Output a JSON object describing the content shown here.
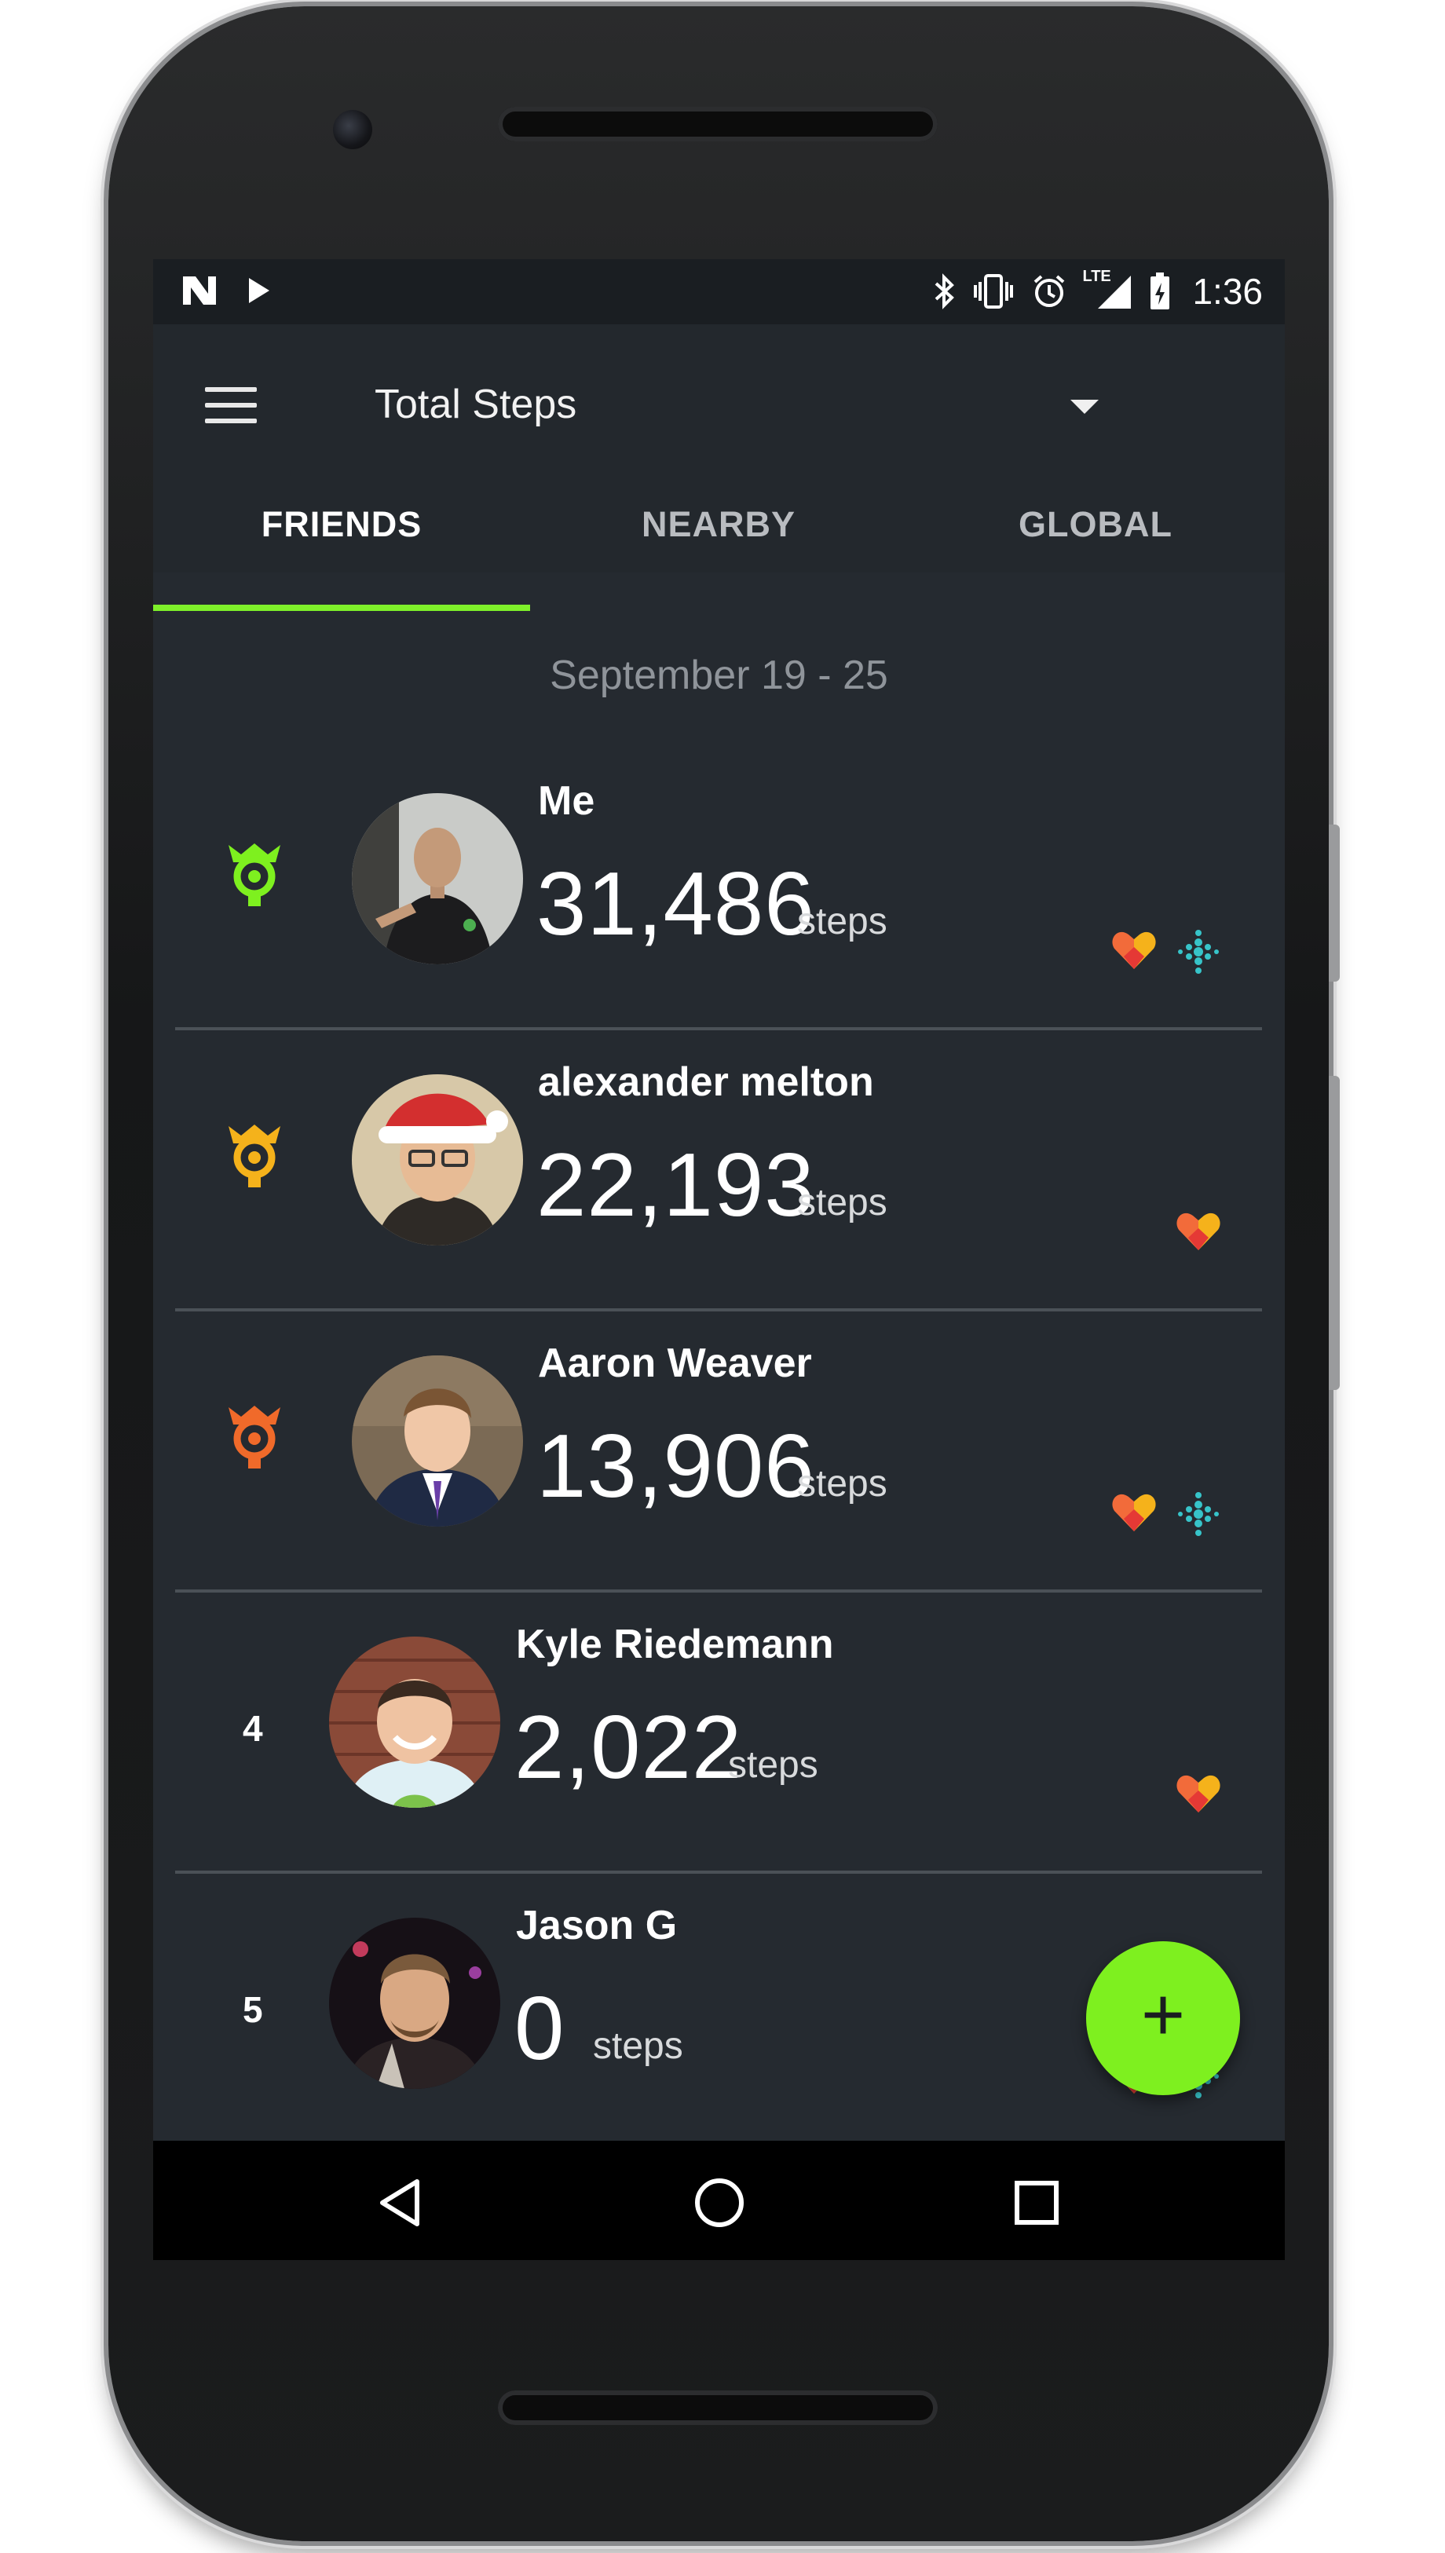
{
  "status_bar": {
    "time": "1:36",
    "network": "LTE",
    "left_icons": [
      "notification-n-icon",
      "play-store-icon"
    ],
    "right_icons": [
      "bluetooth-icon",
      "vibrate-icon",
      "alarm-icon",
      "signal-icon",
      "battery-icon"
    ]
  },
  "appbar": {
    "title": "Total Steps",
    "menu_icon": "menu-icon",
    "dropdown_icon": "dropdown-arrow-icon"
  },
  "tabs": [
    {
      "label": "FRIENDS",
      "active": true
    },
    {
      "label": "NEARBY",
      "active": false
    },
    {
      "label": "GLOBAL",
      "active": false
    }
  ],
  "date_range": "September 19 - 25",
  "leaderboard": [
    {
      "rank": "1",
      "badge_color": "#7ef01f",
      "name": "Me",
      "steps": "31,486",
      "unit": "steps",
      "sources": [
        "google-fit-icon",
        "fitbit-icon"
      ]
    },
    {
      "rank": "2",
      "badge_color": "#f5b21b",
      "name": "alexander melton",
      "steps": "22,193",
      "unit": "steps",
      "sources": [
        "google-fit-icon"
      ]
    },
    {
      "rank": "3",
      "badge_color": "#f06a2a",
      "name": "Aaron Weaver",
      "steps": "13,906",
      "unit": "steps",
      "sources": [
        "google-fit-icon",
        "fitbit-icon"
      ]
    },
    {
      "rank": "4",
      "badge_color": "",
      "name": "Kyle Riedemann",
      "steps": "2,022",
      "unit": "steps",
      "sources": [
        "google-fit-icon"
      ]
    },
    {
      "rank": "5",
      "badge_color": "",
      "name": "Jason G",
      "steps": "0",
      "unit": "steps",
      "sources": [
        "google-fit-icon",
        "fitbit-icon"
      ]
    }
  ],
  "fab": {
    "label": "+",
    "icon": "add-icon"
  },
  "nav_bar": [
    "back-icon",
    "home-icon",
    "recents-icon"
  ],
  "colors": {
    "accent": "#7ef01f",
    "background": "#252a30",
    "appbar": "#23282d"
  }
}
